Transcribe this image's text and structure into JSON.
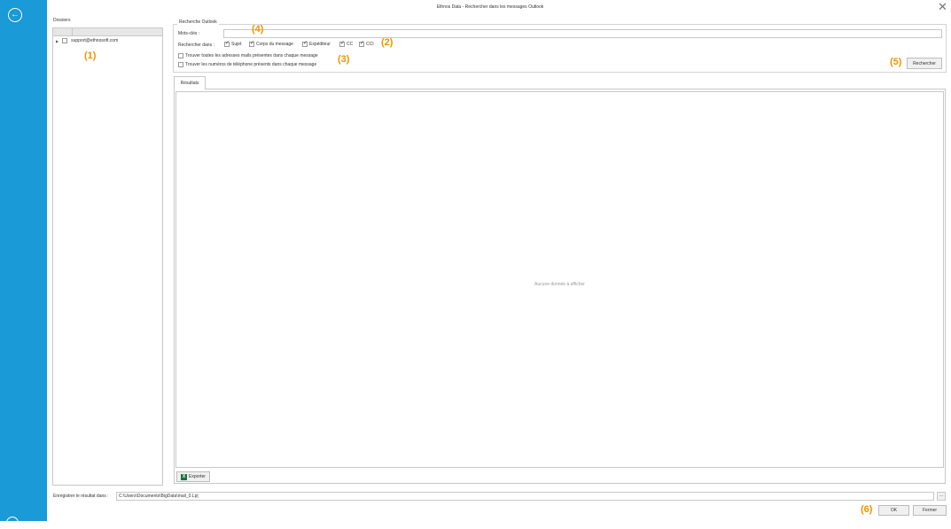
{
  "window": {
    "title": "Ethnos Data - Rechercher dans les messages Outlook"
  },
  "sidebar": {
    "back_icon": "arrow-left-circle-icon",
    "accent": "#1a9ad6"
  },
  "folders": {
    "label": "Dossiers",
    "items": [
      {
        "label": "support@ethnosoft.com",
        "checked": false
      }
    ]
  },
  "search": {
    "group_title": "Recherche Outlook",
    "keywords_label": "Mots-clés :",
    "keywords_value": "",
    "search_in_label": "Rechercher dans :",
    "options": [
      {
        "label": "Sujet",
        "checked": true
      },
      {
        "label": "Corps du message",
        "checked": true
      },
      {
        "label": "Expéditeur",
        "checked": true
      },
      {
        "label": "CC",
        "checked": true
      },
      {
        "label": "CCI",
        "checked": true
      }
    ],
    "find_emails_label": "Trouver toutes les adresses mails présentes dans chaque message",
    "find_phones_label": "Trouver les numéros de téléphone présents dans chaque message",
    "search_button": "Rechercher"
  },
  "results": {
    "tab_label": "Résultats",
    "empty_text": "Aucune donnée à afficher",
    "export_button": "Exporter"
  },
  "save": {
    "label": "Enregistrer le résultat dans :",
    "path": "C:\\Users\\Documents\\BigData\\mail_0.Lp|",
    "browse_label": "..."
  },
  "footer": {
    "ok_button": "OK",
    "close_button": "Fermer"
  },
  "markers": {
    "m1": "(1)",
    "m2": "(2)",
    "m3": "(3)",
    "m4": "(4)",
    "m5": "(5)",
    "m6": "(6)",
    "color": "#f39200"
  }
}
